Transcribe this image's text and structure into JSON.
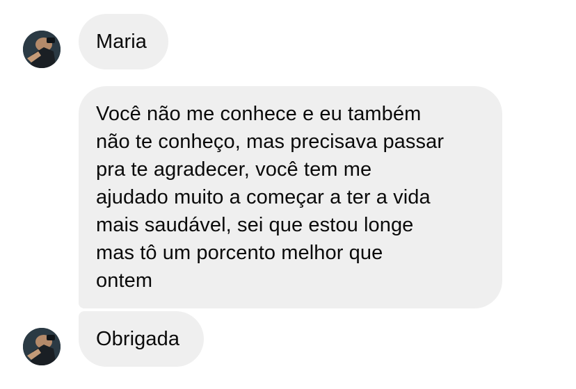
{
  "messages": [
    {
      "sender_avatar": "profile-photo",
      "lines": [
        "Maria"
      ]
    },
    {
      "sender_avatar": null,
      "lines": [
        "Você não me conhece e eu também",
        "não te conheço, mas precisava passar",
        "pra te agradecer, você tem me",
        "ajudado muito a começar a ter a vida",
        "mais saudável, sei que estou longe",
        "mas tô um porcento melhor que",
        "ontem"
      ]
    },
    {
      "sender_avatar": "profile-photo",
      "lines": [
        "Obrigada"
      ]
    }
  ],
  "colors": {
    "bubble_background": "#efefef",
    "text": "#0a0a0a",
    "page_background": "#ffffff"
  }
}
